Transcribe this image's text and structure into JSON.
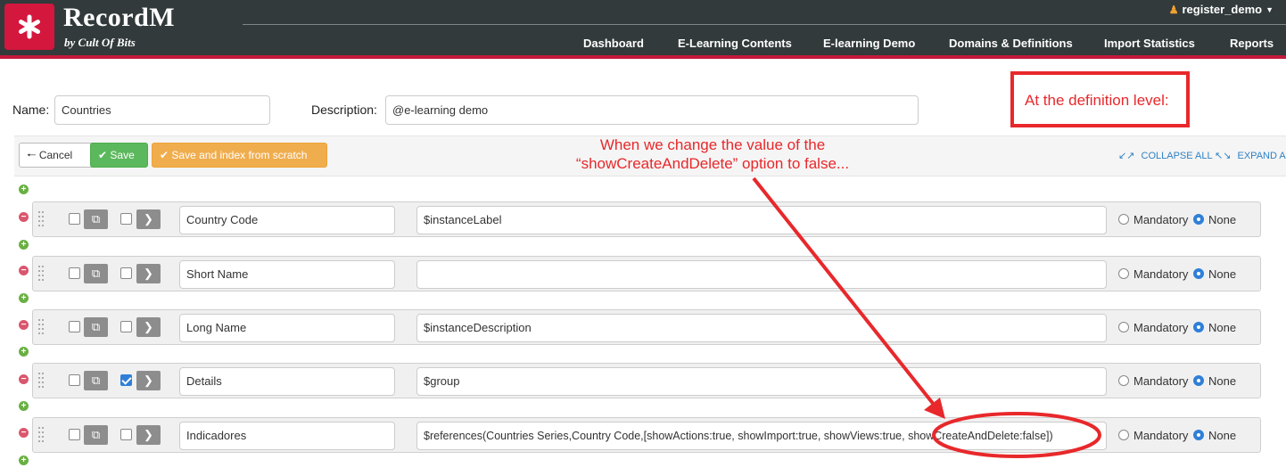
{
  "app": {
    "brand": "RecordM",
    "tagline": "by Cult Of Bits",
    "user": "register_demo"
  },
  "nav": [
    "Dashboard",
    "E-Learning Contents",
    "E-learning Demo",
    "Domains & Definitions",
    "Import Statistics",
    "Reports"
  ],
  "form": {
    "name_label": "Name:",
    "name_value": "Countries",
    "description_label": "Description:",
    "description_value": "@e-learning demo"
  },
  "toolbar": {
    "cancel": "Cancel",
    "save": "Save",
    "save_index": "Save and index from scratch",
    "collapse_all": "COLLAPSE ALL",
    "expand_all": "EXPAND ALL"
  },
  "fields": [
    {
      "name": "Country Code",
      "description": "$instanceLabel",
      "checked": false,
      "mandatory_label": "Mandatory",
      "none_label": "None"
    },
    {
      "name": "Short Name",
      "description": "",
      "checked": false,
      "mandatory_label": "Mandatory",
      "none_label": "None"
    },
    {
      "name": "Long Name",
      "description": "$instanceDescription",
      "checked": false,
      "mandatory_label": "Mandatory",
      "none_label": "None"
    },
    {
      "name": "Details",
      "description": "$group",
      "checked": true,
      "mandatory_label": "Mandatory",
      "none_label": "None"
    },
    {
      "name": "Indicadores",
      "description": "$references(Countries Series,Country Code,[showActions:true, showImport:true, showViews:true, showCreateAndDelete:false])",
      "checked": false,
      "mandatory_label": "Mandatory",
      "none_label": "None"
    }
  ],
  "annotations": {
    "box_text": "At the definition level:",
    "line1": "When we change the value of the",
    "line2": "“showCreateAndDelete” option to false..."
  },
  "colors": {
    "header_bg": "#323a3b",
    "accent_red": "#c4193c",
    "save_green": "#5cb85c",
    "index_orange": "#f0ad4e",
    "annotation_red": "#e8282b",
    "link_blue": "#2f82c4"
  },
  "icons": {
    "logo": "asterisk-icon",
    "user": "person-icon",
    "cancel": "arrow-left-icon",
    "save": "check-icon",
    "collapse": "collapse-arrows-icon",
    "expand": "expand-arrows-icon",
    "row_copy": "copy-icon",
    "row_expand": "chevron-right-icon"
  }
}
